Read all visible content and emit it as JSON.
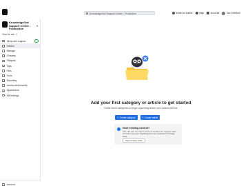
{
  "header": {
    "brand": "KnowledgeOwl",
    "search_text": "KnowledgeOwl Support Center - Production",
    "actions": [
      {
        "label": "Invite an author",
        "icon": "person-plus-icon"
      },
      {
        "label": "Help",
        "icon": "help-icon"
      },
      {
        "label": "Account",
        "icon": "building-icon"
      },
      {
        "label": "Jon Creheon",
        "icon": "avatar-icon"
      }
    ]
  },
  "sidebar": {
    "kb_title": "KnowledgeOwl Support Center - Production",
    "view_site": "View kb site",
    "items": [
      {
        "label": "Setup and support",
        "icon": "checklist-icon"
      },
      {
        "label": "Articles",
        "icon": "document-icon",
        "active": true
      },
      {
        "label": "Manage",
        "icon": "book-icon"
      },
      {
        "label": "Glossary",
        "icon": "glossary-icon"
      },
      {
        "label": "Snippets",
        "icon": "snippet-icon"
      },
      {
        "label": "Tags",
        "icon": "tag-icon"
      },
      {
        "label": "Files",
        "icon": "file-icon"
      },
      {
        "label": "Tools",
        "icon": "wrench-icon"
      },
      {
        "label": "Reporting",
        "icon": "chart-icon"
      },
      {
        "label": "Access and security",
        "icon": "lock-icon"
      },
      {
        "label": "Appearance",
        "icon": "palette-icon"
      },
      {
        "label": "KB Settings",
        "icon": "gear-icon"
      }
    ],
    "account": "Account"
  },
  "main": {
    "empty_title": "Add your first category or article to get started",
    "empty_subtitle": "Create some categories to begin organizing where your content will live.",
    "buttons": [
      {
        "label": "Create category"
      },
      {
        "label": "Create article"
      }
    ],
    "info": {
      "title": "Have existing content?",
      "text": "You can use our Import tools or contact our support team for help if you are migrating from an existing knowledge base.",
      "button": "Open Import tools"
    }
  },
  "colors": {
    "primary": "#1f6fe5",
    "active_bg": "#edeff2",
    "badge": "#3aa34d",
    "folder": "#f4c642"
  }
}
